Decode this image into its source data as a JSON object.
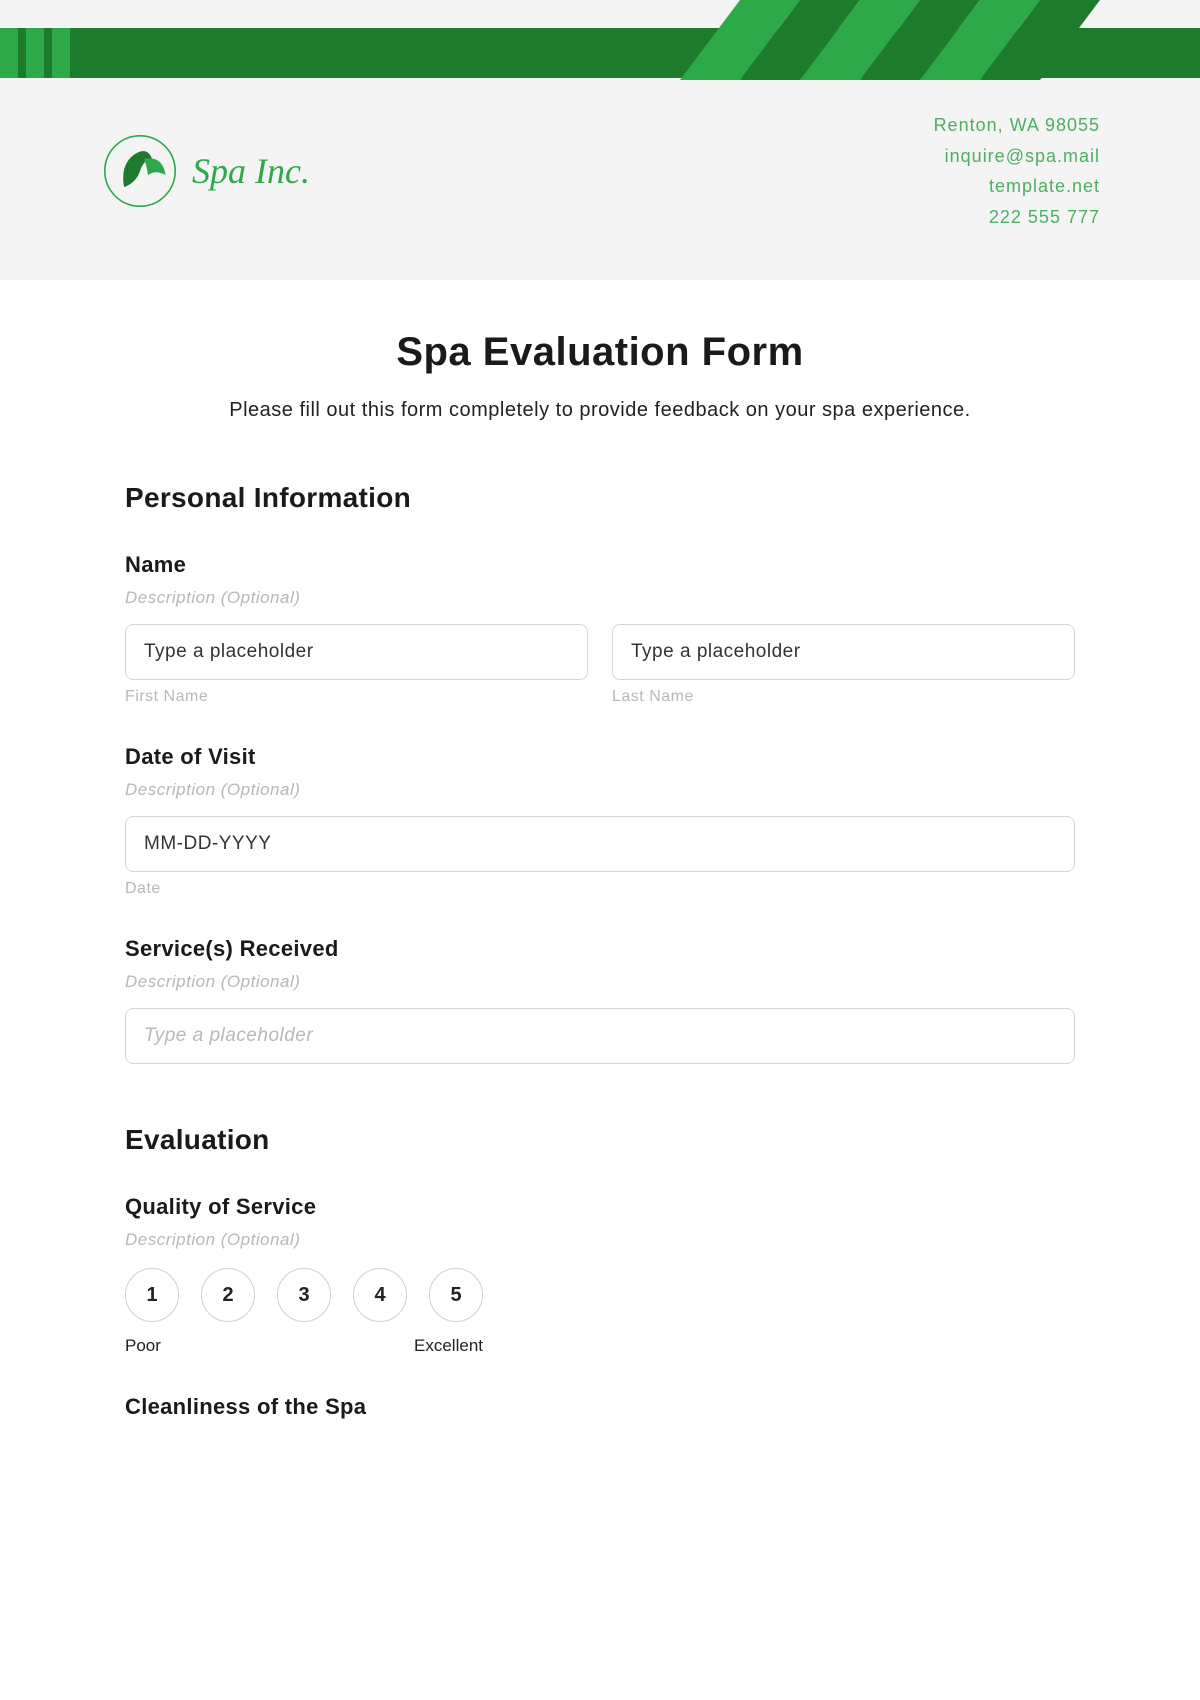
{
  "header": {
    "brand_name": "Spa Inc.",
    "contact": {
      "address": "Renton, WA 98055",
      "email": "inquire@spa.mail",
      "website": "template.net",
      "phone": "222 555 777"
    }
  },
  "form": {
    "title": "Spa Evaluation Form",
    "subtitle": "Please fill out this form completely to provide feedback on your spa experience.",
    "sections": {
      "personal": {
        "heading": "Personal Information",
        "name": {
          "label": "Name",
          "desc": "Description (Optional)",
          "first_placeholder": "Type a placeholder",
          "first_sub": "First Name",
          "last_placeholder": "Type a placeholder",
          "last_sub": "Last Name"
        },
        "date": {
          "label": "Date of Visit",
          "desc": "Description (Optional)",
          "placeholder": "MM-DD-YYYY",
          "sub": "Date"
        },
        "services": {
          "label": "Service(s) Received",
          "desc": "Description (Optional)",
          "placeholder": "Type a placeholder"
        }
      },
      "evaluation": {
        "heading": "Evaluation",
        "quality": {
          "label": "Quality of Service",
          "desc": "Description (Optional)",
          "options": [
            "1",
            "2",
            "3",
            "4",
            "5"
          ],
          "low": "Poor",
          "high": "Excellent"
        },
        "cleanliness": {
          "label": "Cleanliness of the Spa"
        }
      }
    }
  }
}
